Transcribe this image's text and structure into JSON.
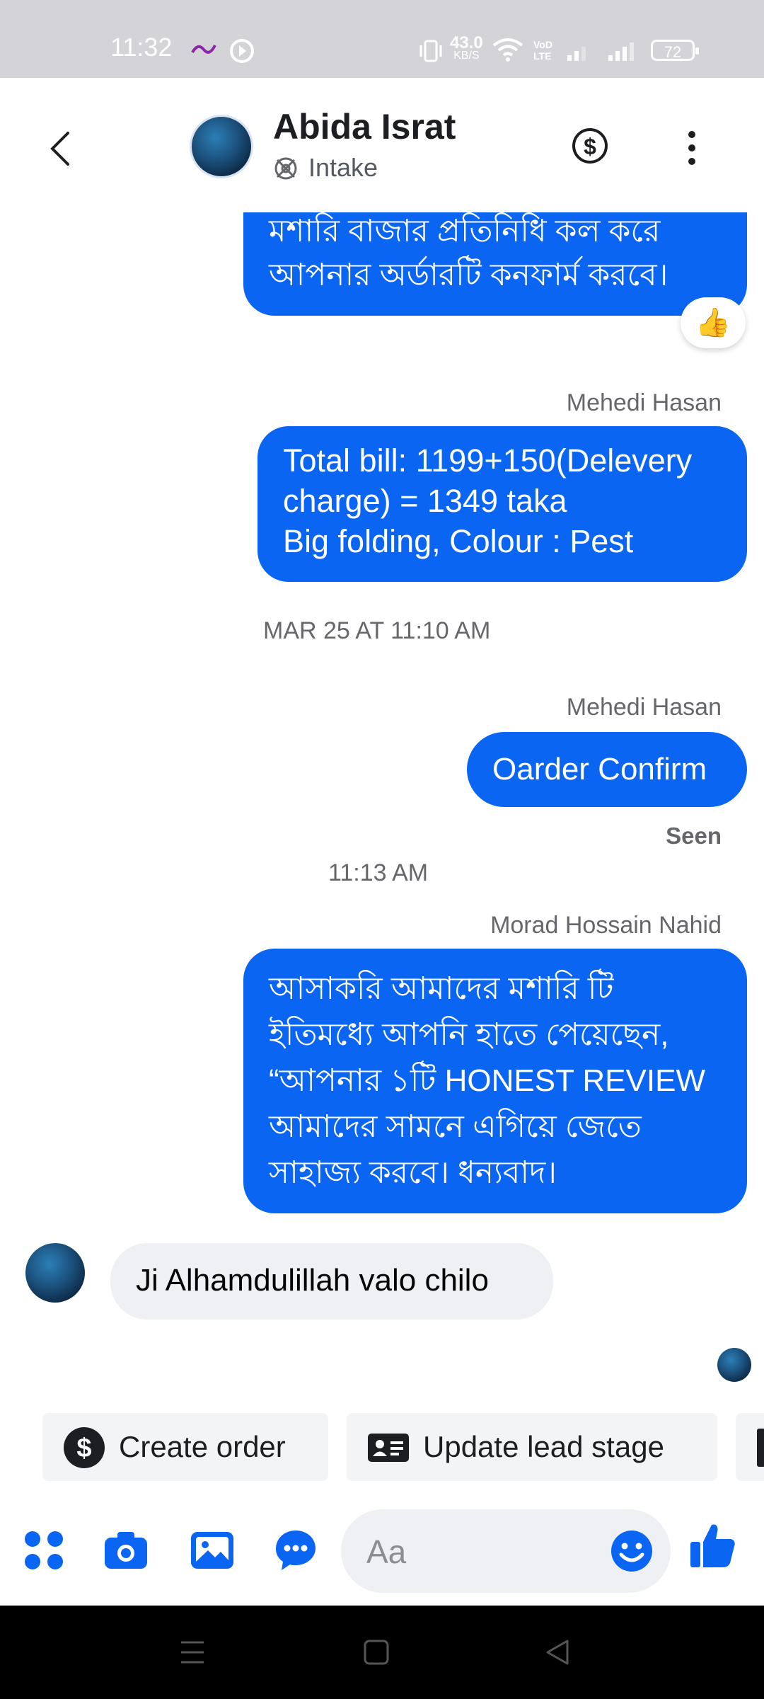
{
  "status_bar": {
    "time": "11:32",
    "net_speed_value": "43.0",
    "net_speed_unit": "KB/S",
    "battery": "72"
  },
  "header": {
    "contact_name": "Abida Israt",
    "label": "Intake"
  },
  "messages": {
    "m1_text_line1": "মশারি বাজার প্রতিনিধি কল করে",
    "m1_text_line2": "আপনার অর্ডারটি কনফার্ম করবে।",
    "m1_reaction": "👍",
    "m2_sender": "Mehedi Hasan",
    "m2_line1": "Total bill: 1199+150(Delevery",
    "m2_line2": "charge) = 1349 taka",
    "m2_line3": "Big folding, Colour : Pest",
    "time1": "MAR 25 AT 11:10 AM",
    "m3_sender": "Mehedi Hasan",
    "m3_text": "Oarder Confirm",
    "seen": "Seen",
    "time2": "11:13 AM",
    "m4_sender": "Morad Hossain Nahid",
    "m4_line1": "আসাকরি আমাদের মশারি টি",
    "m4_line2": "ইতিমধ্যে আপনি হাতে পেয়েছেন,",
    "m4_line3": "“আপনার ১টি HONEST REVIEW",
    "m4_line4": "আমাদের সামনে এগিয়ে জেতে",
    "m4_line5": "সাহাজ্য করবে। ধন্যবাদ।",
    "m5_text": "Ji Alhamdulillah valo chilo"
  },
  "quick_actions": {
    "create_order": "Create order",
    "update_lead_stage": "Update lead stage"
  },
  "composer": {
    "placeholder": "Aa"
  },
  "colors": {
    "accent": "#0a66f2",
    "incoming_bubble": "#eff0f3"
  }
}
